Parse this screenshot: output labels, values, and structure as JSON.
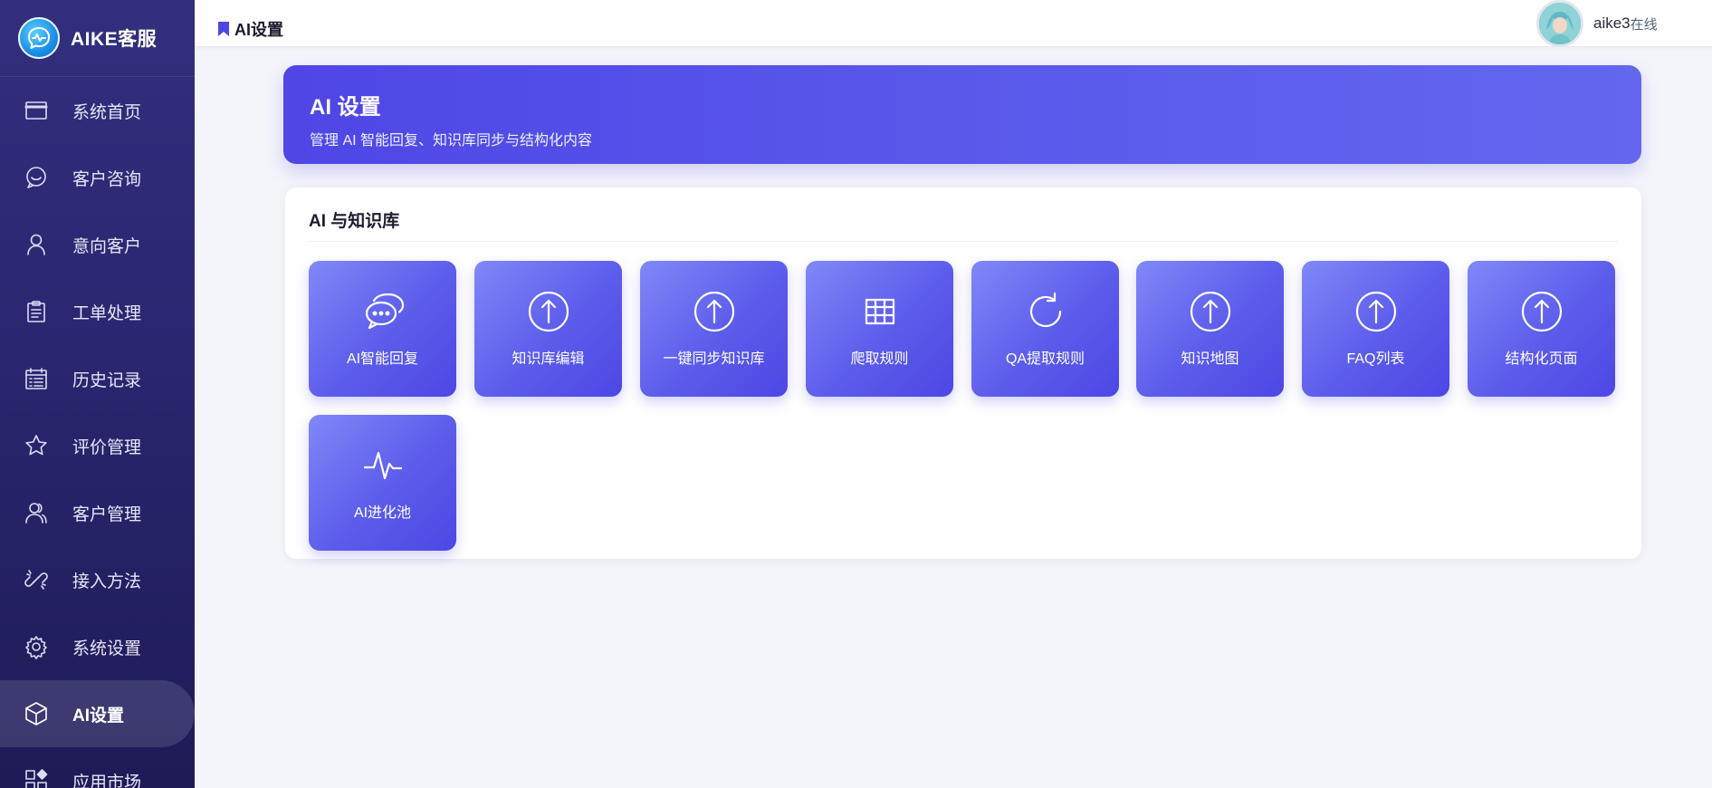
{
  "brand": {
    "name": "AIKE客服"
  },
  "sidebar": {
    "items": [
      {
        "label": "系统首页",
        "icon": "home-window-icon"
      },
      {
        "label": "客户咨询",
        "icon": "chat-smile-icon"
      },
      {
        "label": "意向客户",
        "icon": "user-icon"
      },
      {
        "label": "工单处理",
        "icon": "clipboard-icon"
      },
      {
        "label": "历史记录",
        "icon": "calendar-list-icon"
      },
      {
        "label": "评价管理",
        "icon": "star-icon"
      },
      {
        "label": "客户管理",
        "icon": "users-icon"
      },
      {
        "label": "接入方法",
        "icon": "link-icon"
      },
      {
        "label": "系统设置",
        "icon": "gear-icon"
      },
      {
        "label": "AI设置",
        "icon": "cube-icon",
        "active": true
      },
      {
        "label": "应用市场",
        "icon": "apps-grid-icon"
      }
    ]
  },
  "header": {
    "breadcrumb": "AI设置",
    "user": {
      "name": "aike3",
      "status": "在线"
    }
  },
  "banner": {
    "title": "AI 设置",
    "subtitle": "管理 AI 智能回复、知识库同步与结构化内容"
  },
  "card": {
    "title": "AI 与知识库",
    "tiles": [
      {
        "label": "AI智能回复",
        "icon": "chat-bubbles-icon"
      },
      {
        "label": "知识库编辑",
        "icon": "upload-circle-icon"
      },
      {
        "label": "一键同步知识库",
        "icon": "upload-circle-icon"
      },
      {
        "label": "爬取规则",
        "icon": "table-grid-icon"
      },
      {
        "label": "QA提取规则",
        "icon": "refresh-icon"
      },
      {
        "label": "知识地图",
        "icon": "upload-circle-icon"
      },
      {
        "label": "FAQ列表",
        "icon": "upload-circle-icon"
      },
      {
        "label": "结构化页面",
        "icon": "upload-circle-icon"
      },
      {
        "label": "AI进化池",
        "icon": "pulse-icon"
      }
    ]
  },
  "colors": {
    "accent": "#4f46e5",
    "sidebar": "#2a2670",
    "background": "#f4f5fb"
  }
}
